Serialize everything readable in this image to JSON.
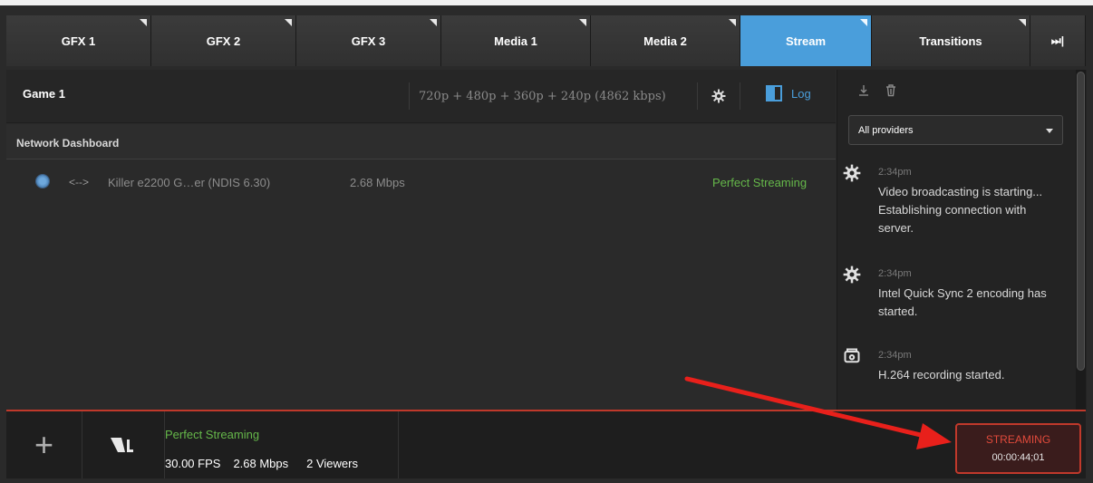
{
  "tabs": [
    {
      "label": "GFX 1",
      "active": false
    },
    {
      "label": "GFX 2",
      "active": false
    },
    {
      "label": "GFX 3",
      "active": false
    },
    {
      "label": "Media 1",
      "active": false
    },
    {
      "label": "Media 2",
      "active": false
    },
    {
      "label": "Stream",
      "active": true
    },
    {
      "label": "Transitions",
      "active": false
    },
    {
      "label": "⏭|",
      "active": false
    }
  ],
  "header": {
    "title": "Game 1",
    "resolutions": "720p + 480p + 360p + 240p (4862 kbps)",
    "log_label": "Log"
  },
  "network": {
    "title": "Network Dashboard",
    "adapter": "Killer e2200 G…er (NDIS 6.30)",
    "direction_symbol": "<-->",
    "rate": "2.68 Mbps",
    "status": "Perfect Streaming"
  },
  "sidebar": {
    "filter": "All providers",
    "messages": [
      {
        "icon": "gear-icon",
        "time": "2:34pm",
        "text": "Video broadcasting is starting... Establishing connection with server."
      },
      {
        "icon": "gear-icon",
        "time": "2:34pm",
        "text": "Intel Quick Sync 2 encoding has started."
      },
      {
        "icon": "recorder-icon",
        "time": "2:34pm",
        "text": "H.264 recording started."
      }
    ]
  },
  "status_bar": {
    "status": "Perfect Streaming",
    "fps": "30.00 FPS",
    "rate": "2.68 Mbps",
    "viewers": "2 Viewers"
  },
  "stream_button": {
    "label": "STREAMING",
    "time": "00:00:44;01"
  },
  "colors": {
    "accent": "#4a9edb",
    "ok_green": "#65b84a",
    "alert_red": "#c0392b"
  }
}
